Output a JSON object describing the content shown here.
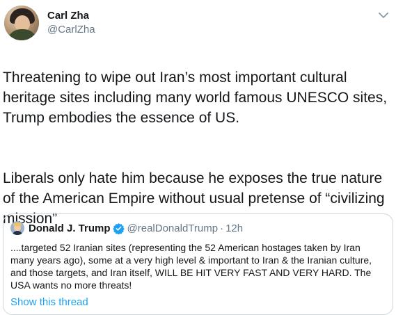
{
  "author": {
    "display_name": "Carl Zha",
    "handle": "@CarlZha"
  },
  "tweet": {
    "paragraphs": [
      "Threatening to wipe out Iran’s most important cultural heritage sites including many world famous UNESCO sites, Trump embodies the essence of US.",
      "Liberals only hate him because he exposes the true nature of the American Empire without usual pretense of “civilizing mission”"
    ]
  },
  "quoted_tweet": {
    "display_name": "Donald J. Trump",
    "handle": "@realDonaldTrump",
    "separator": "·",
    "time": "12h",
    "text": "....targeted 52 Iranian sites (representing the 52 American hostages taken by Iran many years ago), some at a very high level & important to Iran &  the Iranian culture, and those targets, and Iran itself, WILL BE HIT VERY FAST AND VERY HARD. The USA wants no more threats!",
    "show_thread_label": "Show this thread"
  },
  "icons": {
    "caret": "chevron-down-icon",
    "verified": "verified-badge-icon"
  },
  "colors": {
    "link": "#1da1f2",
    "secondary_text": "#657786",
    "border": "#ccd6dd"
  }
}
